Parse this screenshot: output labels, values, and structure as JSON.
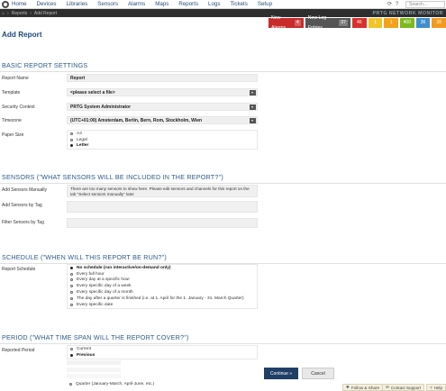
{
  "nav": {
    "items": [
      "Home",
      "Devices",
      "Libraries",
      "Sensors",
      "Alarms",
      "Maps",
      "Reports",
      "Logs",
      "Tickets",
      "Setup"
    ],
    "search_placeholder": "Search..."
  },
  "breadcrumb": [
    "Reports",
    "Add Report"
  ],
  "brand": "PRTG NETWORK MONITOR",
  "status": {
    "new_alarms_label": "New Alarms",
    "new_alarms_count": "4",
    "new_log_label": "New Log Entries",
    "new_log_count": "37",
    "boxes": [
      {
        "count": "46",
        "color": "#d9312b"
      },
      {
        "count": "1",
        "color": "#f0c52a"
      },
      {
        "count": "1",
        "color": "#f3a21a"
      },
      {
        "count": "400",
        "color": "#7cba1e"
      },
      {
        "count": "36",
        "color": "#3f8fcc"
      },
      {
        "count": "28",
        "color": "#f39a1e"
      }
    ]
  },
  "page_title": "Add Report",
  "basic": {
    "heading": "BASIC REPORT SETTINGS",
    "report_name_label": "Report Name",
    "report_name_value": "Report",
    "template_label": "Template",
    "template_value": "<please select a file>",
    "security_label": "Security Context",
    "security_value": "PRTG System Administrator",
    "timezone_label": "Timezone",
    "timezone_value": "(UTC+01:00) Amsterdam, Berlin, Bern, Rom, Stockholm, Wien",
    "paper_label": "Paper Size",
    "paper_options": [
      "A4",
      "Legal",
      "Letter"
    ],
    "paper_selected": 2
  },
  "sensors": {
    "heading": "SENSORS (\"WHAT SENSORS WILL BE INCLUDED IN THE REPORT?\")",
    "manual_label": "Add Sensors Manually",
    "manual_text": "There are too many sensors to show here. Please edit sensors and channels for this report on the tab \"Select sensors manually\" later",
    "bytag_label": "Add Sensors by Tag",
    "filter_label": "Filter Sensors by Tag"
  },
  "schedule": {
    "heading": "SCHEDULE (\"WHEN WILL THIS REPORT BE RUN?\")",
    "label": "Report Schedule",
    "options": [
      "No schedule (run interactive/on-demand only)",
      "Every full hour",
      "Every day at a specific hour",
      "Every specific day of a week",
      "Every specific day of a month",
      "The day after a quarter is finished (i.e. at 1. April for the 1. January - 31. March Quarter)",
      "Every specific date"
    ],
    "selected": 0
  },
  "period": {
    "heading": "PERIOD (\"WHAT TIME SPAN WILL THE REPORT COVER?\")",
    "label": "Reported Period",
    "options": [
      "Current",
      "Previous"
    ],
    "selected": 1,
    "extra_option": "Quarter (January-March, April-June, etc.)"
  },
  "footer": {
    "continue_label": "Continue »",
    "cancel_label": "Cancel",
    "follow_label": "Follow & Share",
    "contact_label": "Contact Support",
    "help_label": "Help"
  }
}
